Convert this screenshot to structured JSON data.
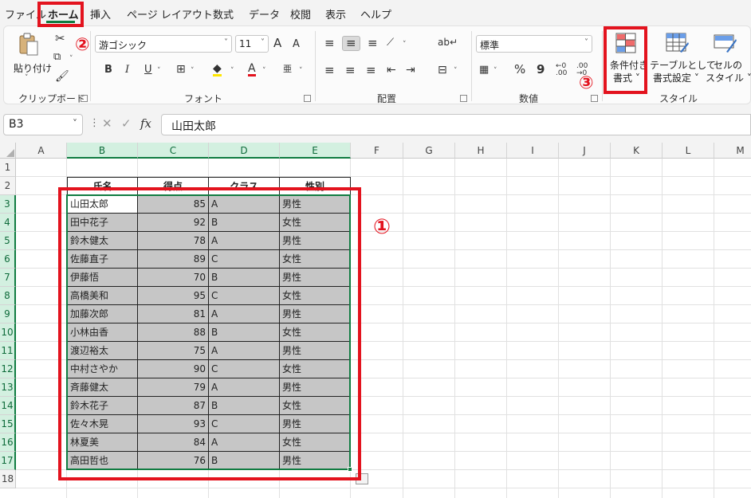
{
  "menu": {
    "tabs": [
      "ファイル",
      "ホーム",
      "挿入",
      "ページ レイアウト",
      "数式",
      "データ",
      "校閲",
      "表示",
      "ヘルプ"
    ],
    "active_tab": "ホーム"
  },
  "ribbon": {
    "clipboard": {
      "paste_label": "貼り付け",
      "group_label": "クリップボード"
    },
    "font": {
      "font_name": "游ゴシック",
      "font_size": "11",
      "grow": "A",
      "shrink": "A",
      "bold": "B",
      "italic": "I",
      "underline": "U",
      "font_color_letter": "A",
      "phonetic": "亜",
      "group_label": "フォント"
    },
    "alignment": {
      "group_label": "配置"
    },
    "number": {
      "format": "標準",
      "percent": "%",
      "comma": "9",
      "group_label": "数値"
    },
    "styles": {
      "conditional_format": [
        "条件付き",
        "書式 ˅"
      ],
      "format_as_table": [
        "テーブルとして",
        "書式設定 ˅"
      ],
      "cell_styles": [
        "セルの",
        "スタイル ˅"
      ],
      "group_label": "スタイル"
    }
  },
  "formula_bar": {
    "name_box": "B3",
    "fx": "fx",
    "content": "山田太郎"
  },
  "sheet": {
    "columns": [
      "A",
      "B",
      "C",
      "D",
      "E",
      "F",
      "G",
      "H",
      "I",
      "J",
      "K",
      "L",
      "M"
    ],
    "rows": [
      "1",
      "2",
      "3",
      "4",
      "5",
      "6",
      "7",
      "8",
      "9",
      "10",
      "11",
      "12",
      "13",
      "14",
      "15",
      "16",
      "17",
      "18"
    ],
    "headers": [
      "氏名",
      "得点",
      "クラス",
      "性別"
    ],
    "data": [
      [
        "山田太郎",
        "85",
        "A",
        "男性"
      ],
      [
        "田中花子",
        "92",
        "B",
        "女性"
      ],
      [
        "鈴木健太",
        "78",
        "A",
        "男性"
      ],
      [
        "佐藤直子",
        "89",
        "C",
        "女性"
      ],
      [
        "伊藤悟",
        "70",
        "B",
        "男性"
      ],
      [
        "高橋美和",
        "95",
        "C",
        "女性"
      ],
      [
        "加藤次郎",
        "81",
        "A",
        "男性"
      ],
      [
        "小林由香",
        "88",
        "B",
        "女性"
      ],
      [
        "渡辺裕太",
        "75",
        "A",
        "男性"
      ],
      [
        "中村さやか",
        "90",
        "C",
        "女性"
      ],
      [
        "斉藤健太",
        "79",
        "A",
        "男性"
      ],
      [
        "鈴木花子",
        "87",
        "B",
        "女性"
      ],
      [
        "佐々木晃",
        "93",
        "C",
        "男性"
      ],
      [
        "林夏美",
        "84",
        "A",
        "女性"
      ],
      [
        "高田哲也",
        "76",
        "B",
        "男性"
      ]
    ]
  },
  "annotations": {
    "step1": "①",
    "step2": "②",
    "step3": "③"
  },
  "colors": {
    "accent": "#107c41",
    "highlight": "#e3131e",
    "selection": "#c6c6c6"
  }
}
